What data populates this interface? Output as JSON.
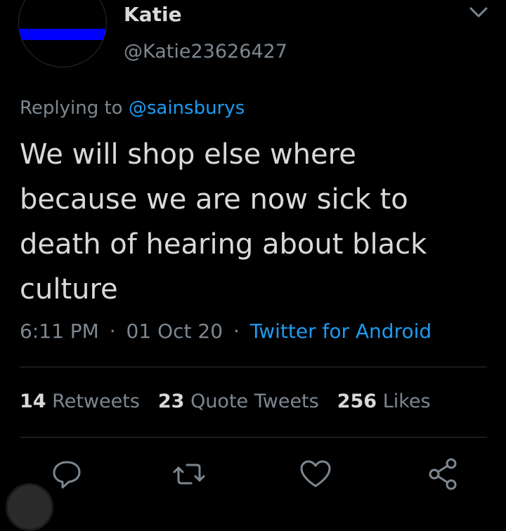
{
  "author": {
    "name": "Katie",
    "handle": "@Katie23626427"
  },
  "reply": {
    "prefix": "Replying to",
    "mention": "@sainsburys"
  },
  "tweet": {
    "text": "We will shop else where because we are now sick to death of hearing about black culture"
  },
  "meta": {
    "time": "6:11 PM",
    "date": "01 Oct 20",
    "source": "Twitter for Android",
    "separator": "·"
  },
  "stats": {
    "retweets_count": "14",
    "retweets_label": "Retweets",
    "quotes_count": "23",
    "quotes_label": "Quote Tweets",
    "likes_count": "256",
    "likes_label": "Likes"
  },
  "icons": {
    "more": "chevron-down-icon",
    "reply": "reply-icon",
    "retweet": "retweet-icon",
    "like": "heart-icon",
    "share": "share-icon"
  },
  "colors": {
    "background": "#000000",
    "text": "#d9d9d9",
    "muted": "#7d8790",
    "accent": "#1d9bf0",
    "avatar_stripe": "#0000ff"
  }
}
